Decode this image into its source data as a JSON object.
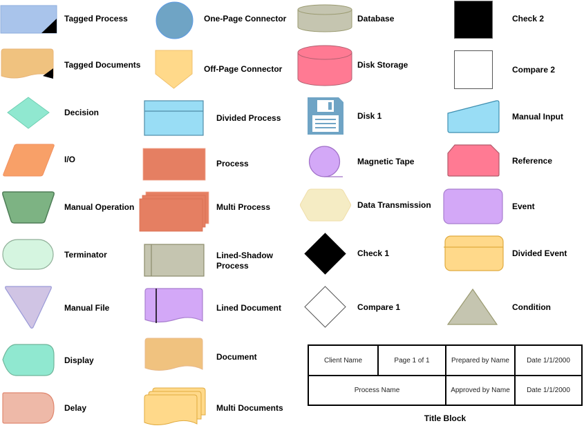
{
  "shapes": {
    "tagged_process": "Tagged Process",
    "tagged_documents": "Tagged Documents",
    "decision": "Decision",
    "io": "I/O",
    "manual_operation": "Manual Operation",
    "terminator": "Terminator",
    "manual_file": "Manual File",
    "display": "Display",
    "delay": "Delay",
    "one_page_connector": "One-Page Connector",
    "off_page_connector": "Off-Page Connector",
    "divided_process": "Divided Process",
    "process": "Process",
    "multi_process": "Multi Process",
    "lined_shadow_process_line1": "Lined-Shadow",
    "lined_shadow_process_line2": "Process",
    "lined_document": "Lined Document",
    "document": "Document",
    "multi_documents": "Multi Documents",
    "database": "Database",
    "disk_storage": "Disk Storage",
    "disk_1": "Disk 1",
    "magnetic_tape": "Magnetic Tape",
    "data_transmission": "Data Transmission",
    "check_1": "Check 1",
    "compare_1": "Compare 1",
    "check_2": "Check 2",
    "compare_2": "Compare 2",
    "manual_input": "Manual Input",
    "reference": "Reference",
    "event": "Event",
    "divided_event": "Divided Event",
    "condition": "Condition"
  },
  "title_block": {
    "title": "Title Block",
    "client_name": "Client Name",
    "page": "Page 1 of 1",
    "prepared_by": "Prepared by Name",
    "date_prepared": "Date 1/1/2000",
    "process_name": "Process Name",
    "approved_by": "Approved by Name",
    "date_approved": "Date 1/1/2000"
  },
  "colors": {
    "blue_process": "#a9c4eb",
    "orange_doc": "#f0c27f",
    "mint": "#90e8d0",
    "salmon_io": "#f8a068",
    "green_manual": "#7db383",
    "terminator": "#d5f5e0",
    "lavender": "#d0c4e4",
    "delay": "#eeb9a8",
    "connector_blue": "#6fa4c5",
    "pale_yellow": "#ffd98a",
    "sky": "#99ddf5",
    "process_red": "#e57f62",
    "khaki": "#c5c5b0",
    "purple": "#d3a8f7",
    "pink": "#ff7a93",
    "cream": "#f5ecc4"
  }
}
